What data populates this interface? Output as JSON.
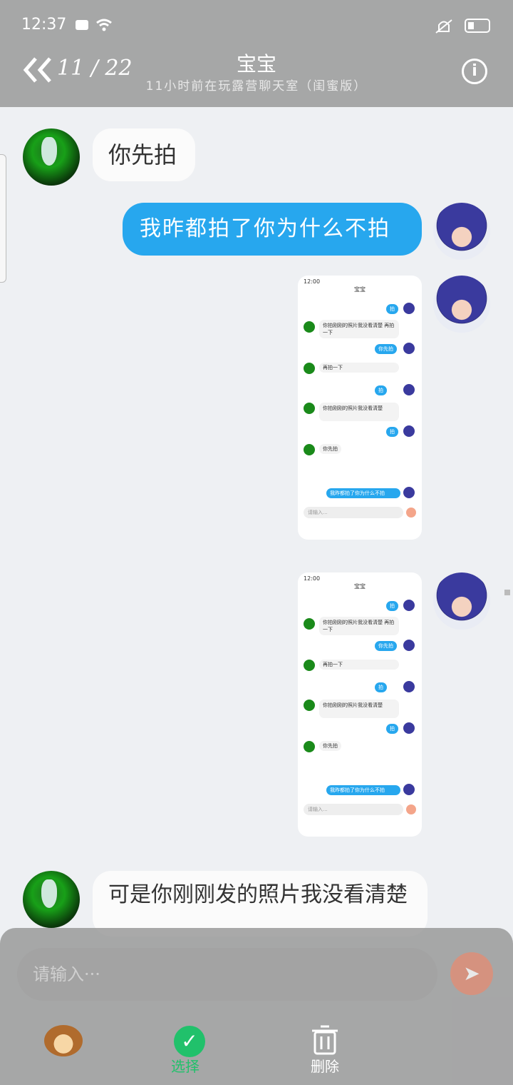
{
  "status": {
    "time": "12:37"
  },
  "header": {
    "counter": "11 / 22",
    "title": "宝宝",
    "subtitle": "11小时前在玩露营聊天室（闺蜜版）"
  },
  "messages": [
    {
      "side": "left",
      "text": "你先拍"
    },
    {
      "side": "right",
      "text": "我昨都拍了你为什么不拍"
    },
    {
      "side": "right",
      "type": "screenshot"
    },
    {
      "side": "right",
      "type": "screenshot"
    },
    {
      "side": "left",
      "text": "可是你刚刚发的照片我没看清楚"
    }
  ],
  "screenshot": {
    "time": "12:00",
    "title": "宝宝",
    "rows": [
      "拍",
      "你拍刚刚的照片我没看清楚 再拍一下",
      "你先拍",
      "再拍一下",
      "你拍刚刚的照片我没看清楚",
      "拍",
      "你先拍",
      "我昨都拍了你为什么不拍"
    ],
    "input_placeholder": "请输入..."
  },
  "input": {
    "placeholder": "请输入···"
  },
  "toolbar": {
    "select_label": "选择",
    "delete_label": "删除"
  },
  "icons": [
    "back-icon",
    "info-icon",
    "send-icon",
    "emoji-monkey-icon",
    "check-icon",
    "trash-icon"
  ]
}
